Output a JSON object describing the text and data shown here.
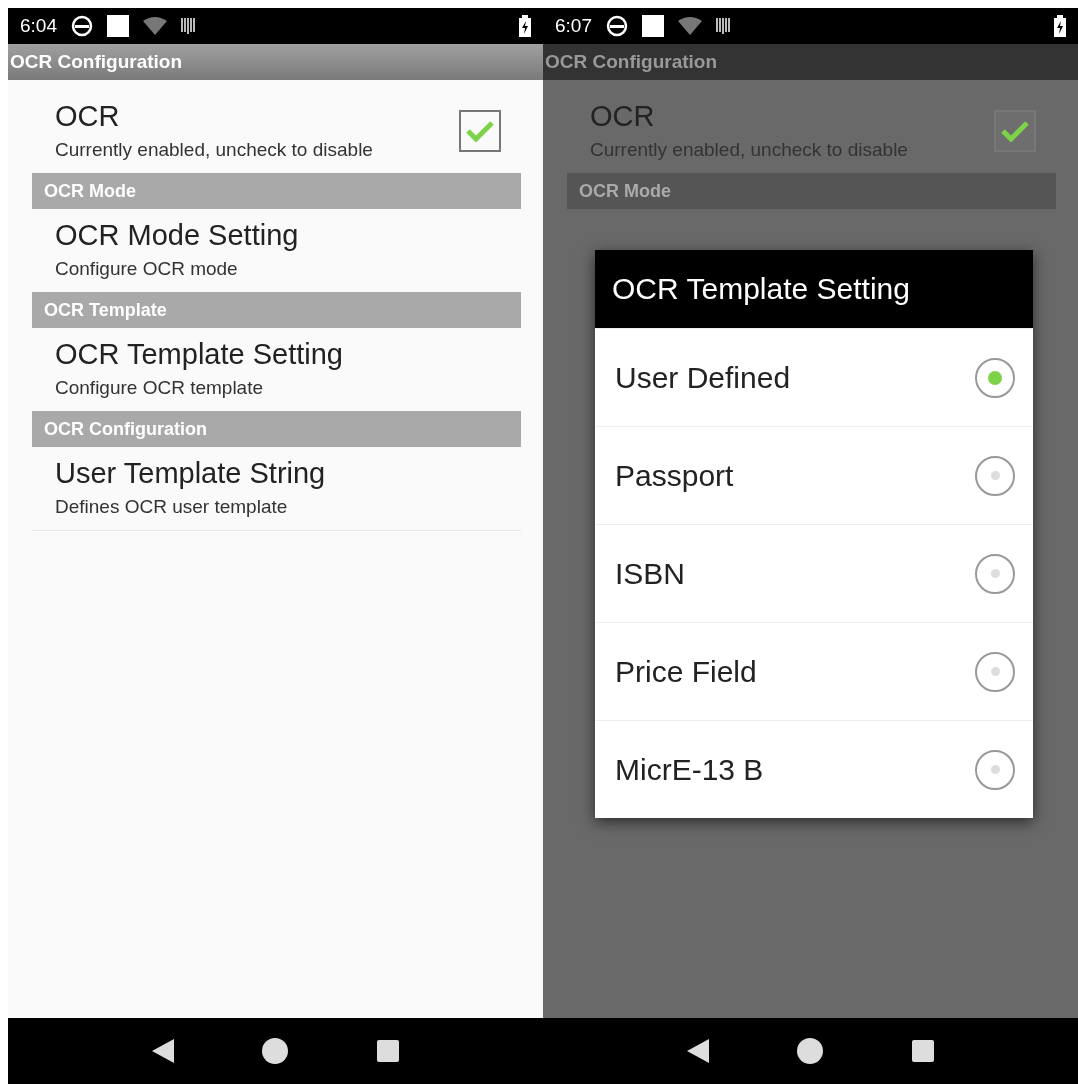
{
  "screens": [
    {
      "status_bar": {
        "time": "6:04"
      },
      "title": "OCR Configuration",
      "items": [
        {
          "kind": "check",
          "title": "OCR",
          "summary": "Currently enabled, uncheck to disable",
          "checked": true
        },
        {
          "kind": "header",
          "title": "OCR Mode"
        },
        {
          "kind": "setting",
          "title": "OCR Mode Setting",
          "summary": "Configure OCR mode"
        },
        {
          "kind": "header",
          "title": "OCR Template"
        },
        {
          "kind": "setting",
          "title": "OCR Template Setting",
          "summary": "Configure OCR template"
        },
        {
          "kind": "header",
          "title": "OCR Configuration"
        },
        {
          "kind": "setting",
          "title": "User Template String",
          "summary": "Defines OCR user template"
        }
      ]
    },
    {
      "status_bar": {
        "time": "6:07"
      },
      "title": "OCR Configuration",
      "items": [
        {
          "kind": "check",
          "title": "OCR",
          "summary": "Currently enabled, uncheck to disable",
          "checked": true
        },
        {
          "kind": "header",
          "title": "OCR Mode"
        }
      ],
      "dialog": {
        "title": "OCR Template Setting",
        "options": [
          {
            "label": "User Defined",
            "selected": true
          },
          {
            "label": "Passport",
            "selected": false
          },
          {
            "label": "ISBN",
            "selected": false
          },
          {
            "label": "Price Field",
            "selected": false
          },
          {
            "label": "MicrE-13 B",
            "selected": false
          }
        ]
      }
    }
  ]
}
